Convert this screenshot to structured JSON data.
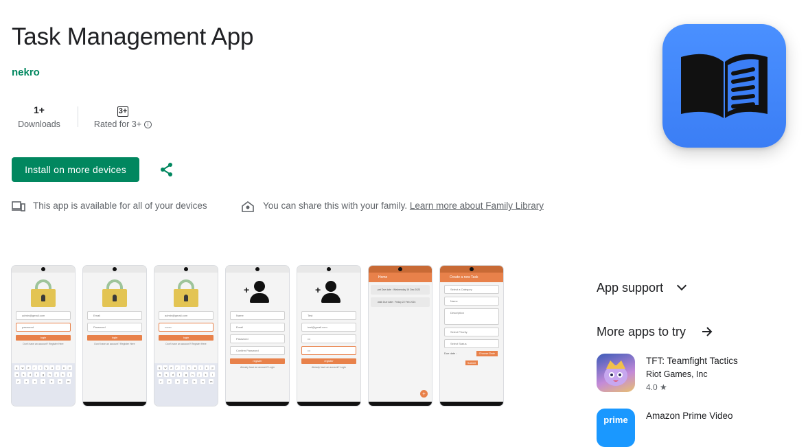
{
  "app": {
    "title": "Task Management App",
    "developer": "nekro",
    "downloads_value": "1+",
    "downloads_label": "Downloads",
    "rating_badge": "3+",
    "rating_label": "Rated for 3+",
    "install_label": "Install on more devices",
    "devices_note": "This app is available for all of your devices",
    "family_note": "You can share this with your family.",
    "family_link": "Learn more about Family Library"
  },
  "colors": {
    "brand": "#01875f",
    "icon_bg": "#3b7ef5",
    "screenshot_accent": "#e8814a"
  },
  "screenshots": {
    "s1": {
      "email": "admin@gmail.com",
      "password": "password",
      "login": "login",
      "hint": "Don't have an account? Register Here"
    },
    "s2": {
      "email": "Email",
      "password": "Password",
      "login": "login",
      "hint": "Don't have an account? Register Here"
    },
    "s3": {
      "email": "admin@gmail.com",
      "password": "•••••••",
      "login": "login",
      "hint": "Don't have an account? Register Here"
    },
    "s4": {
      "name": "Name",
      "email": "Email",
      "password": "Password",
      "confirm": "Confirm Password",
      "register": "register",
      "hint": "Already have an account? Login"
    },
    "s5": {
      "name": "Test",
      "email": "test@gmail.com",
      "password": "•••",
      "confirm": "•••",
      "register": "register",
      "hint": "Already have an account? Login"
    },
    "s6": {
      "header": "Home",
      "task1": "pet  Due date : Wednesday 19 Dec 2023",
      "task2": "walk  Due date : Friday 22 Feb 2024",
      "fab": "+"
    },
    "s7": {
      "header": "Create a new Task",
      "category": "Select a Category",
      "name": "Name",
      "description": "Description",
      "priority": "Select Priority",
      "status": "Select Status",
      "due": "Due date :",
      "choose": "Choose Date",
      "submit": "Submit"
    },
    "keyboard_rows": [
      [
        "q",
        "w",
        "e",
        "r",
        "t",
        "y",
        "u",
        "i",
        "o",
        "p"
      ],
      [
        "a",
        "s",
        "d",
        "f",
        "g",
        "h",
        "j",
        "k",
        "l"
      ],
      [
        "z",
        "x",
        "c",
        "v",
        "b",
        "n",
        "m"
      ]
    ]
  },
  "support": {
    "app_support_label": "App support",
    "more_apps_label": "More apps to try"
  },
  "recommendations": [
    {
      "name": "TFT: Teamfight Tactics",
      "developer": "Riot Games, Inc",
      "rating": "4.0 ★"
    },
    {
      "name": "Amazon Prime Video",
      "icon_text": "prime"
    }
  ],
  "icons": [
    "info-icon",
    "share-icon",
    "devices-icon",
    "family-icon",
    "chevron-down-icon",
    "arrow-right-icon",
    "book-icon"
  ]
}
